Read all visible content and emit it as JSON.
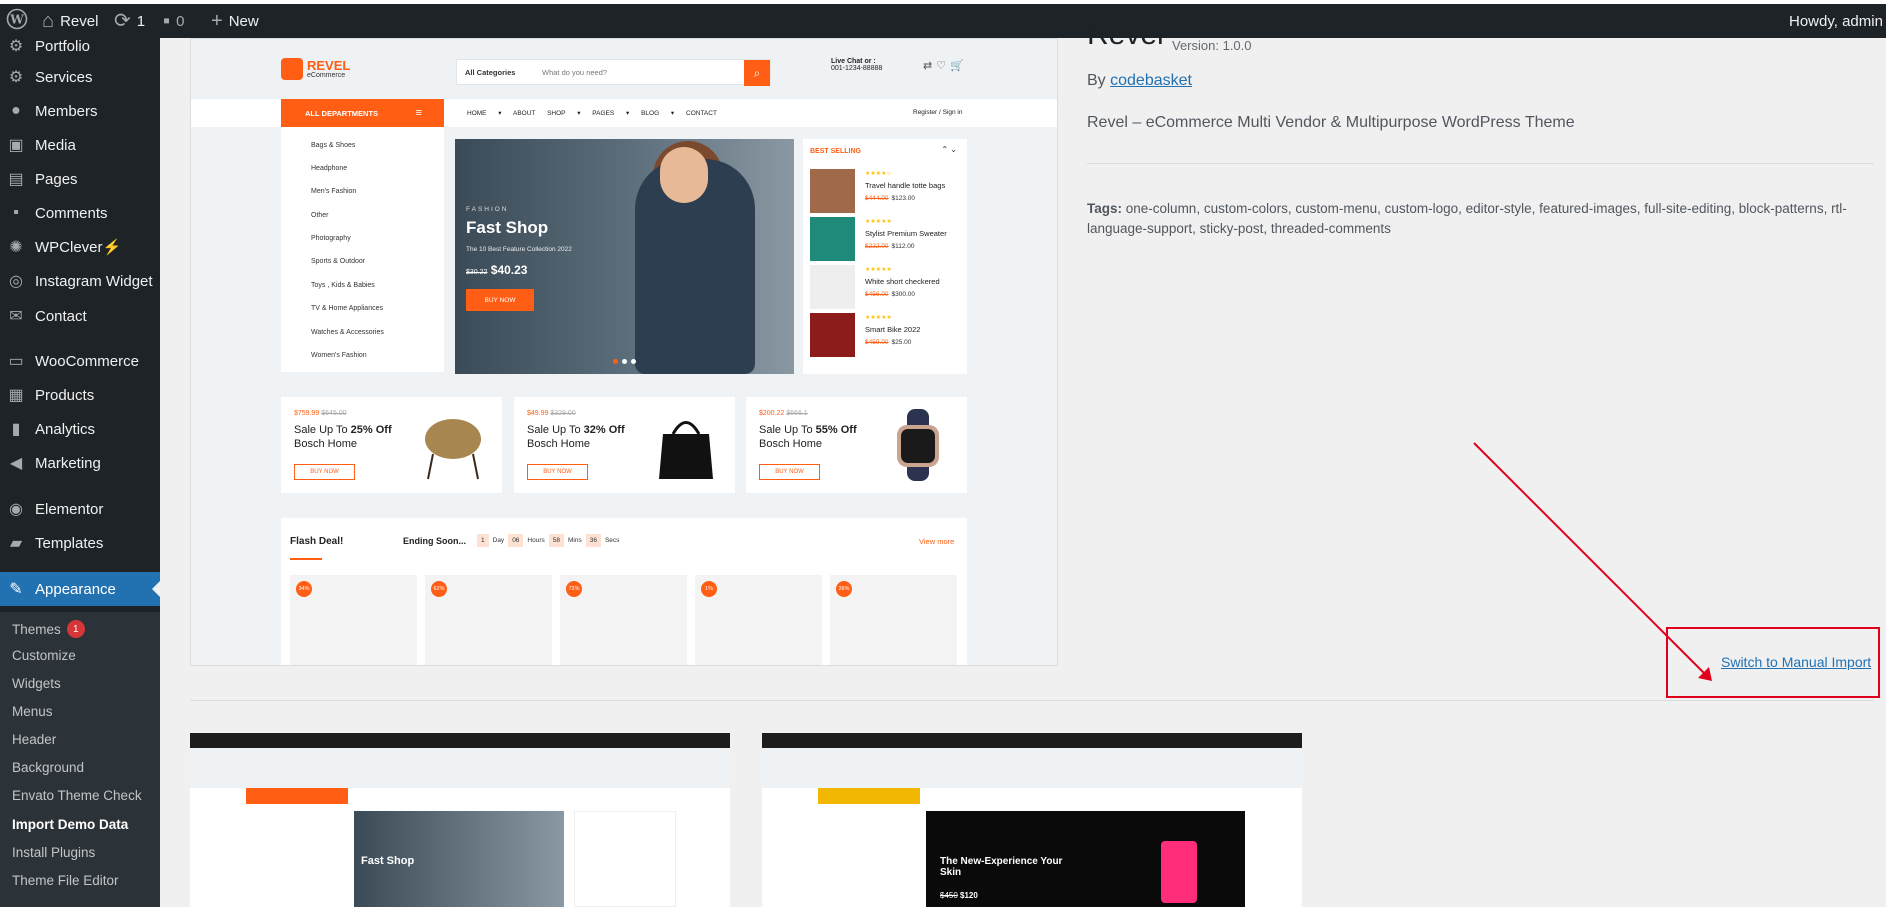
{
  "admin_bar": {
    "site_name": "Revel",
    "updates_count": "1",
    "comments_count": "0",
    "new_label": "New",
    "howdy": "Howdy, admin"
  },
  "sidebar": {
    "items": [
      {
        "label": "Portfolio",
        "icon": "gear-icon"
      },
      {
        "label": "Services",
        "icon": "gear-icon"
      },
      {
        "label": "Members",
        "icon": "user-icon"
      },
      {
        "label": "Media",
        "icon": "media-icon"
      },
      {
        "label": "Pages",
        "icon": "pages-icon"
      },
      {
        "label": "Comments",
        "icon": "comment-icon"
      },
      {
        "label": "WPClever⚡",
        "icon": "wpclever-icon"
      },
      {
        "label": "Instagram Widget",
        "icon": "instagram-icon"
      },
      {
        "label": "Contact",
        "icon": "mail-icon"
      },
      {
        "label": "WooCommerce",
        "icon": "woo-icon"
      },
      {
        "label": "Products",
        "icon": "archive-icon"
      },
      {
        "label": "Analytics",
        "icon": "chart-icon"
      },
      {
        "label": "Marketing",
        "icon": "megaphone-icon"
      },
      {
        "label": "Elementor",
        "icon": "elementor-icon"
      },
      {
        "label": "Templates",
        "icon": "folder-icon"
      },
      {
        "label": "Appearance",
        "icon": "brush-icon"
      }
    ],
    "submenu": [
      {
        "label": "Themes",
        "badge": "1"
      },
      {
        "label": "Customize"
      },
      {
        "label": "Widgets"
      },
      {
        "label": "Menus"
      },
      {
        "label": "Header"
      },
      {
        "label": "Background"
      },
      {
        "label": "Envato Theme Check"
      },
      {
        "label": "Import Demo Data"
      },
      {
        "label": "Install Plugins"
      },
      {
        "label": "Theme File Editor"
      }
    ]
  },
  "theme": {
    "title": "Revel",
    "version": "Version: 1.0.0",
    "by": "By",
    "author": "codebasket",
    "description": "Revel – eCommerce Multi Vendor & Multipurpose WordPress Theme",
    "tags_label": "Tags:",
    "tags": "one-column, custom-colors, custom-menu, custom-logo, editor-style, featured-images, full-site-editing, block-patterns, rtl-language-support, sticky-post, threaded-comments",
    "manual_import": "Switch to Manual Import"
  },
  "preview": {
    "logo": "REVEL",
    "logo_sub": "eCommerce",
    "search_category": "All Categories",
    "search_placeholder": "What do you need?",
    "live_chat": "Live Chat or :",
    "phone": "001-1234-88888",
    "all_departments": "ALL DEPARTMENTS",
    "nav": "HOME ▾   ABOUT   SHOP ▾   PAGES ▾   BLOG ▾   CONTACT",
    "register": "Register / Sign in",
    "categories": [
      "Bags & Shoes",
      "Headphone",
      "Men's Fashion",
      "Other",
      "Photography",
      "Sports & Outdoor",
      "Toys , Kids & Babies",
      "TV & Home Appliances",
      "Watches & Accessories",
      "Women's Fashion"
    ],
    "hero": {
      "label": "FASHION",
      "title": "Fast Shop",
      "subtitle": "The 10 Best Feature Collection 2022",
      "old_price": "$30.22",
      "price": "$40.23",
      "button": "BUY NOW"
    },
    "best_selling": {
      "title": "BEST SELLING",
      "items": [
        {
          "name": "Travel handle totte bags",
          "old": "$444.00",
          "price": "$123.00"
        },
        {
          "name": "Stylist Premium Sweater",
          "old": "$222.00",
          "price": "$112.00"
        },
        {
          "name": "White short checkered",
          "old": "$456.00",
          "price": "$300.00"
        },
        {
          "name": "Smart Bike 2022",
          "old": "$459.00",
          "price": "$25.00"
        }
      ]
    },
    "promos": [
      {
        "price": "$759.99",
        "old": "$645.00",
        "line1_pre": "Sale Up To ",
        "line1_bold": "25% Off",
        "line2": "Bosch Home",
        "button": "BUY NOW"
      },
      {
        "price": "$49.99",
        "old": "$329.00",
        "line1_pre": "Sale Up To ",
        "line1_bold": "32% Off",
        "line2": "Bosch Home",
        "button": "BUY NOW"
      },
      {
        "price": "$200.22",
        "old": "$666.1",
        "line1_pre": "Sale Up To ",
        "line1_bold": "55% Off",
        "line2": "Bosch Home",
        "button": "BUY NOW"
      }
    ],
    "flash": {
      "title": "Flash Deal!",
      "ending": "Ending Soon...",
      "day_val": "1",
      "day": "Day",
      "hours_val": "06",
      "hours": "Hours",
      "mins_val": "58",
      "mins": "Mins",
      "secs_val": "36",
      "secs": "Secs",
      "view_more": "View more",
      "discounts": [
        "34%",
        "62%",
        "72%",
        "1%",
        "26%"
      ]
    }
  },
  "thumb2": {
    "headline": "The New-Experience Your Skin",
    "price": "$120",
    "old": "$450"
  }
}
